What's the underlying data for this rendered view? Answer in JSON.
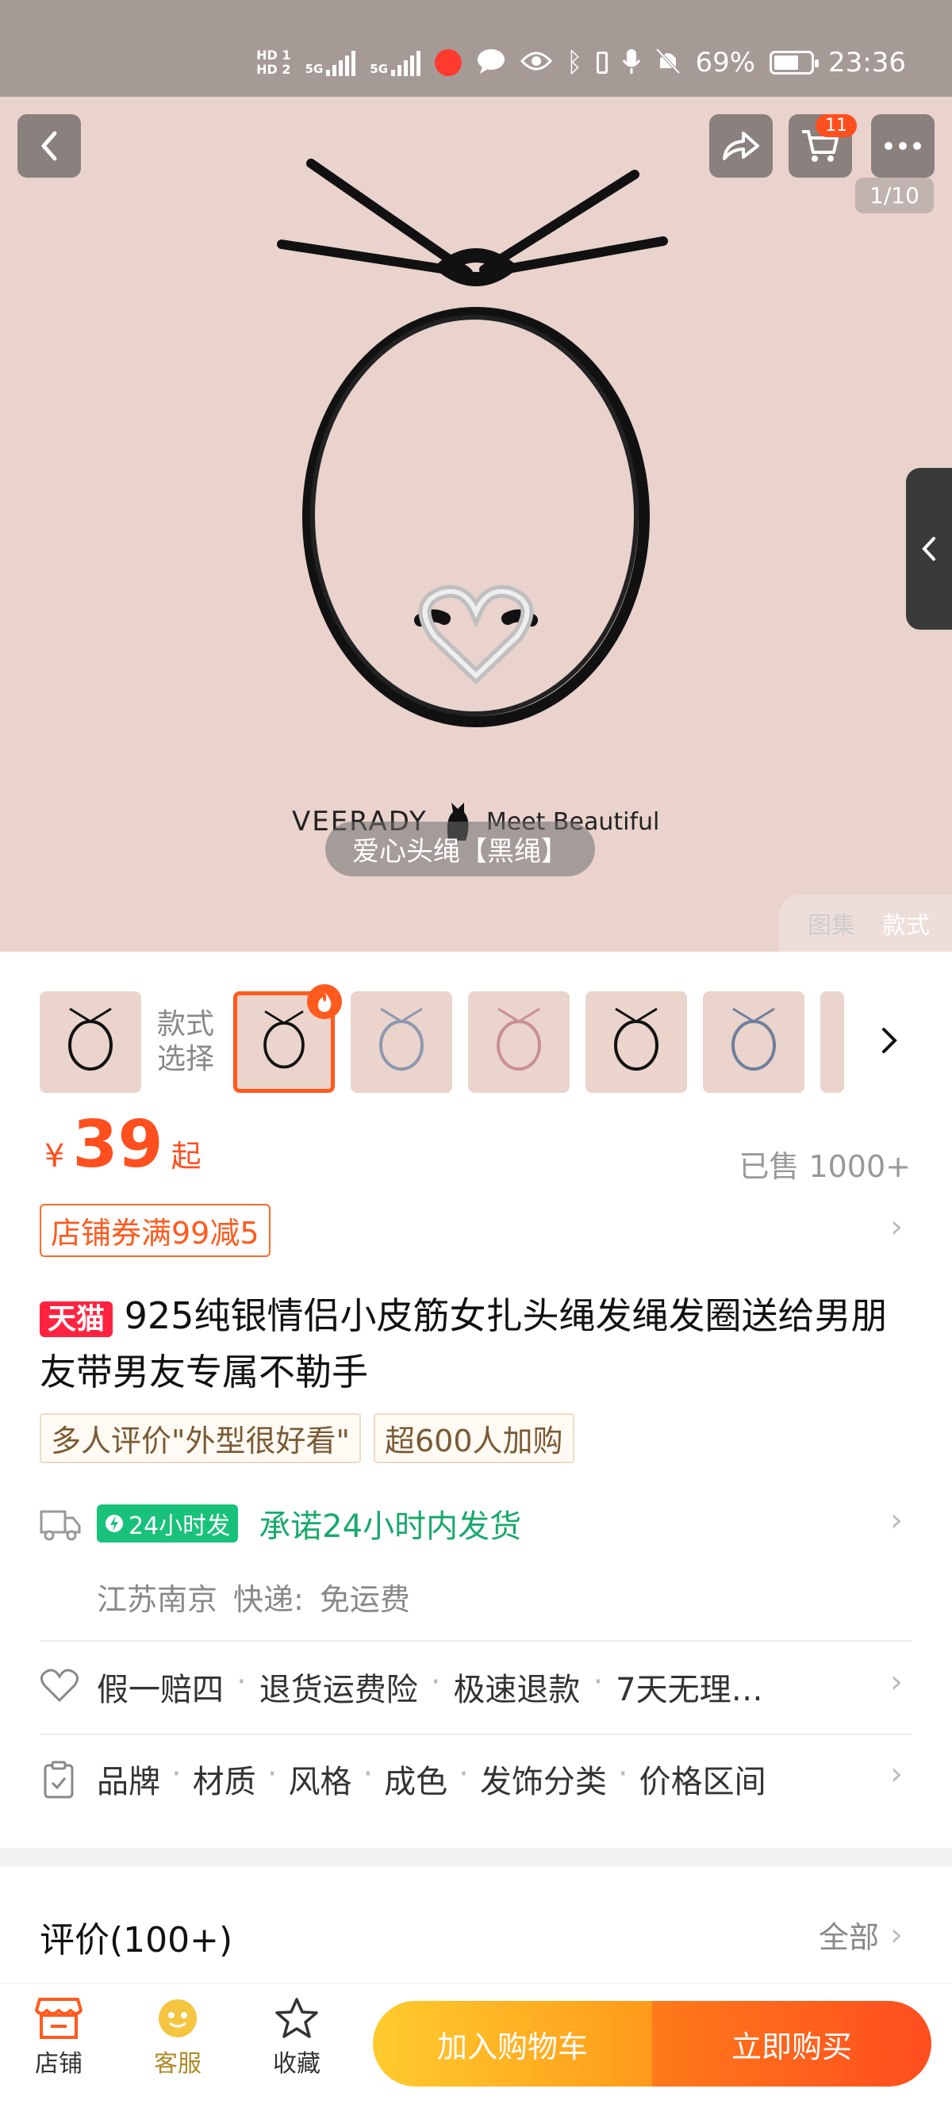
{
  "status_bar": {
    "sim1": "HD 1",
    "sim2": "HD 2",
    "network1": "5G",
    "network2": "5G",
    "battery": "69%",
    "battery_level": 0.69,
    "time": "23:36"
  },
  "hero": {
    "cart_count": "11",
    "page_counter": "1/10",
    "brand_left": "VEERADY",
    "brand_right": "Meet Beautiful",
    "caption": "爱心头绳【黑绳】",
    "tabs": [
      "图集",
      "款式"
    ]
  },
  "style_picker": {
    "label_line1": "款式",
    "label_line2": "选择"
  },
  "price": {
    "currency": "¥",
    "amount": "39",
    "suffix": "起",
    "sold": "已售 1000+",
    "coupon": "店铺券满99减5"
  },
  "product": {
    "platform_badge": "天猫",
    "title": "925纯银情侣小皮筋女扎头绳发绳发圈送给男朋友带男友专属不勒手",
    "tags": [
      "多人评价\"外型很好看\"",
      "超600人加购"
    ]
  },
  "shipping": {
    "badge": "24小时发",
    "promise": "承诺24小时内发货",
    "origin": "江苏南京",
    "method": "快递:",
    "fee": "免运费"
  },
  "services": [
    "假一赔四",
    "退货运费险",
    "极速退款",
    "7天无理…"
  ],
  "attributes": [
    "品牌",
    "材质",
    "风格",
    "成色",
    "发饰分类",
    "价格区间"
  ],
  "reviews": {
    "title": "评价(100+)",
    "all": "全部"
  },
  "bottom_bar": {
    "shop": "店铺",
    "service": "客服",
    "favorite": "收藏",
    "add_to_cart": "加入购物车",
    "buy_now": "立即购买"
  },
  "colors": {
    "accent": "#ff4f1f",
    "tmall_red": "#ff2340",
    "green": "#19c27a",
    "hero_bg": "#e9d3cc"
  },
  "icons": [
    "back-icon",
    "share-icon",
    "cart-icon",
    "more-icon",
    "fire-icon",
    "chevron-right-icon",
    "truck-icon",
    "lightning-icon",
    "heart-icon",
    "clipboard-icon",
    "shop-icon",
    "service-icon",
    "star-icon"
  ]
}
